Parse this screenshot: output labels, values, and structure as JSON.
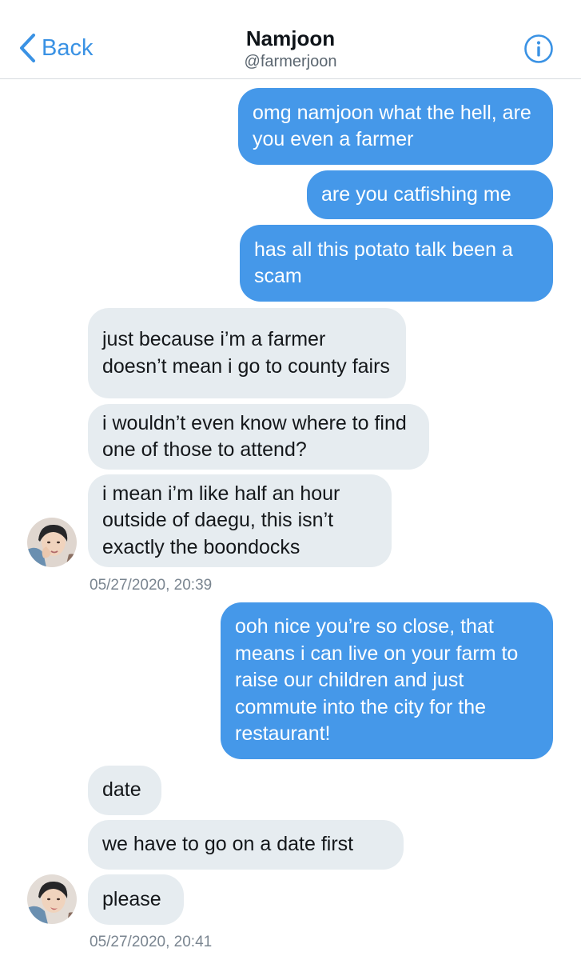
{
  "header": {
    "back_label": "Back",
    "name": "Namjoon",
    "handle": "@farmerjoon"
  },
  "messages": [
    {
      "from": "me",
      "text": "omg namjoon what the hell, are you even a farmer"
    },
    {
      "from": "me",
      "text": "are you catfishing me"
    },
    {
      "from": "me",
      "text": "has all this potato talk been a scam"
    },
    {
      "from": "them",
      "text": "just because i’m a farmer doesn’t mean i go to county fairs"
    },
    {
      "from": "them",
      "text": "i wouldn’t even know where to find one of those to attend?"
    },
    {
      "from": "them",
      "text": "i mean i’m like half an hour outside of daegu, this isn’t exactly the boondocks"
    },
    {
      "from": "me",
      "text": "ooh nice you’re so close, that means i can live on your farm to raise our children and just commute into the city for the restaurant!"
    },
    {
      "from": "them",
      "text": "date"
    },
    {
      "from": "them",
      "text": "we have to go on a date first"
    },
    {
      "from": "them",
      "text": "please"
    }
  ],
  "timestamps": [
    "05/27/2020, 20:39",
    "05/27/2020, 20:41"
  ],
  "colors": {
    "accent": "#3a92e4",
    "sent_bubble": "#4598e9",
    "received_bubble": "#e6ecf0"
  }
}
